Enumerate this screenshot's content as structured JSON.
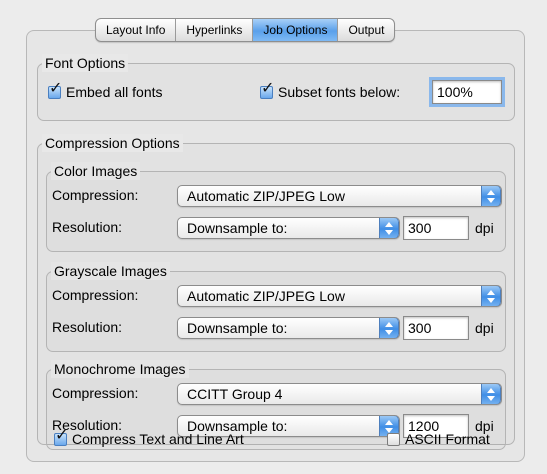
{
  "tabs": [
    {
      "label": "Layout Info",
      "selected": false
    },
    {
      "label": "Hyperlinks",
      "selected": false
    },
    {
      "label": "Job Options",
      "selected": true
    },
    {
      "label": "Output",
      "selected": false
    }
  ],
  "font_options": {
    "title": "Font Options",
    "embed_all_fonts": {
      "label": "Embed all fonts",
      "checked": true
    },
    "subset_fonts": {
      "label": "Subset fonts below:",
      "checked": true,
      "value": "100%"
    }
  },
  "compression": {
    "title": "Compression Options",
    "color": {
      "title": "Color Images",
      "compression_label": "Compression:",
      "compression_value": "Automatic ZIP/JPEG Low",
      "resolution_label": "Resolution:",
      "resolution_value": "Downsample to:",
      "dpi_value": "300",
      "dpi_unit": "dpi"
    },
    "grayscale": {
      "title": "Grayscale Images",
      "compression_label": "Compression:",
      "compression_value": "Automatic ZIP/JPEG Low",
      "resolution_label": "Resolution:",
      "resolution_value": "Downsample to:",
      "dpi_value": "300",
      "dpi_unit": "dpi"
    },
    "monochrome": {
      "title": "Monochrome Images",
      "compression_label": "Compression:",
      "compression_value": "CCITT Group 4",
      "resolution_label": "Resolution:",
      "resolution_value": "Downsample to:",
      "dpi_value": "1200",
      "dpi_unit": "dpi"
    }
  },
  "bottom": {
    "compress_text": {
      "label": "Compress Text and Line Art",
      "checked": true
    },
    "ascii_format": {
      "label": "ASCII Format",
      "checked": false
    }
  },
  "colors": {
    "selected_tab": "#5aa0ea",
    "focus_ring": "#8ab8ec",
    "popup_arrow": "#3f8ee6"
  },
  "icons": {
    "checkmark": "checkmark-icon",
    "popup_arrows": "up-down-arrows-icon"
  }
}
